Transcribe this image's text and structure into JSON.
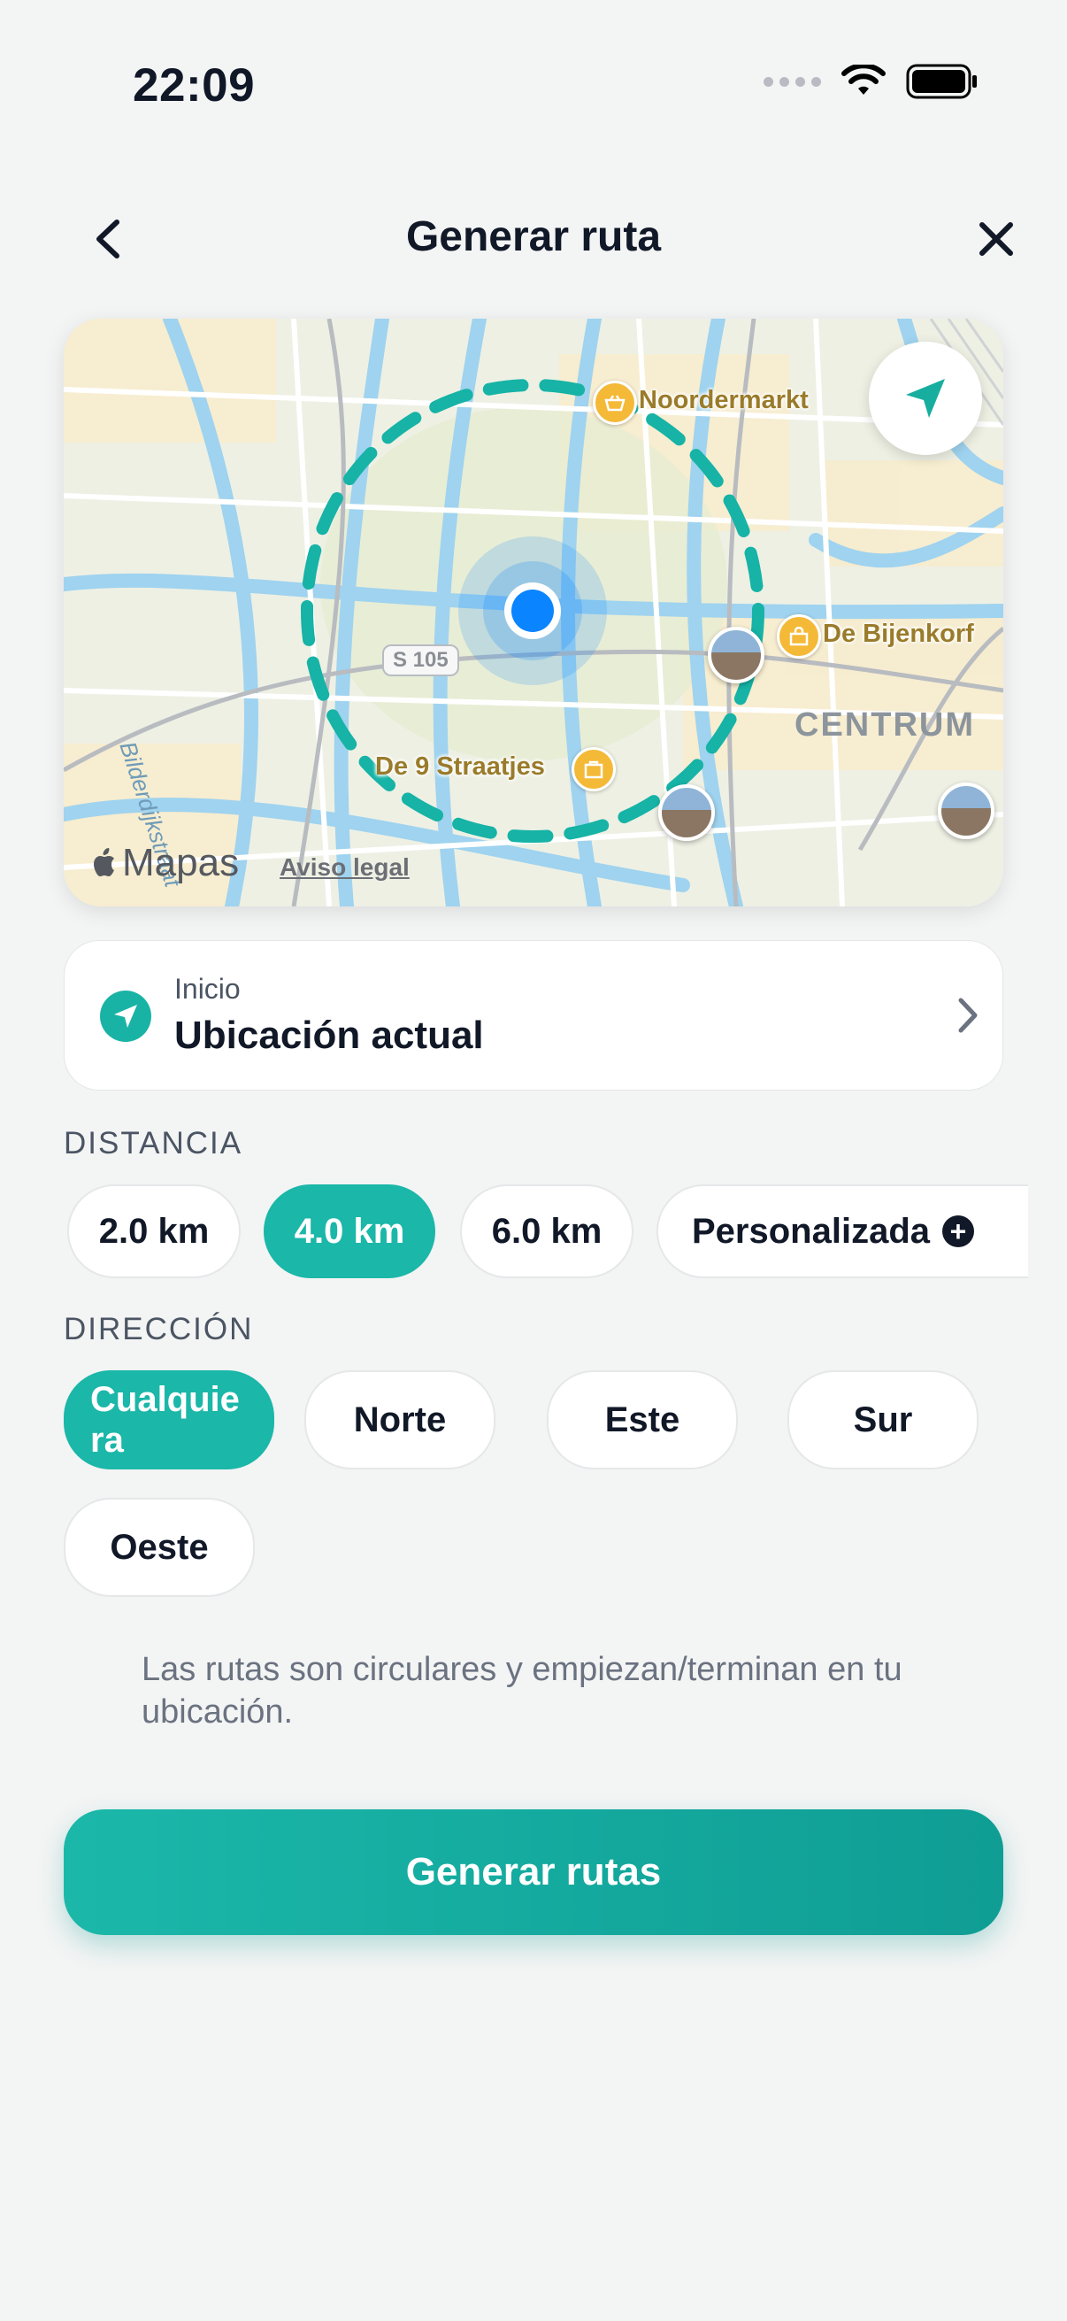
{
  "status_bar": {
    "time": "22:09"
  },
  "header": {
    "title": "Generar ruta"
  },
  "map": {
    "pois": [
      "Noordermarkt",
      "De Bijenkorf",
      "De 9 Straatjes"
    ],
    "district": "CENTRUM",
    "road_shield": "S 105",
    "street": "Bilderdijkstraat",
    "brand": "Mapas",
    "legal": "Aviso legal"
  },
  "start": {
    "label": "Inicio",
    "value": "Ubicación actual"
  },
  "distance": {
    "label": "DISTANCIA",
    "options": [
      "2.0 km",
      "4.0 km",
      "6.0 km",
      "Personalizada"
    ],
    "selected": "4.0 km"
  },
  "direction": {
    "label": "DIRECCIÓN",
    "options": [
      "Cualquiera",
      "Norte",
      "Este",
      "Sur",
      "Oeste"
    ],
    "selected": "Cualquiera",
    "selected_wrapped": [
      "Cualquie",
      "ra"
    ]
  },
  "helper": "Las rutas son circulares y empiezan/terminan en tu ubicación.",
  "cta": "Generar rutas",
  "colors": {
    "accent": "#1bb7a9",
    "location_blue": "#0a84ff",
    "text": "#111827"
  }
}
